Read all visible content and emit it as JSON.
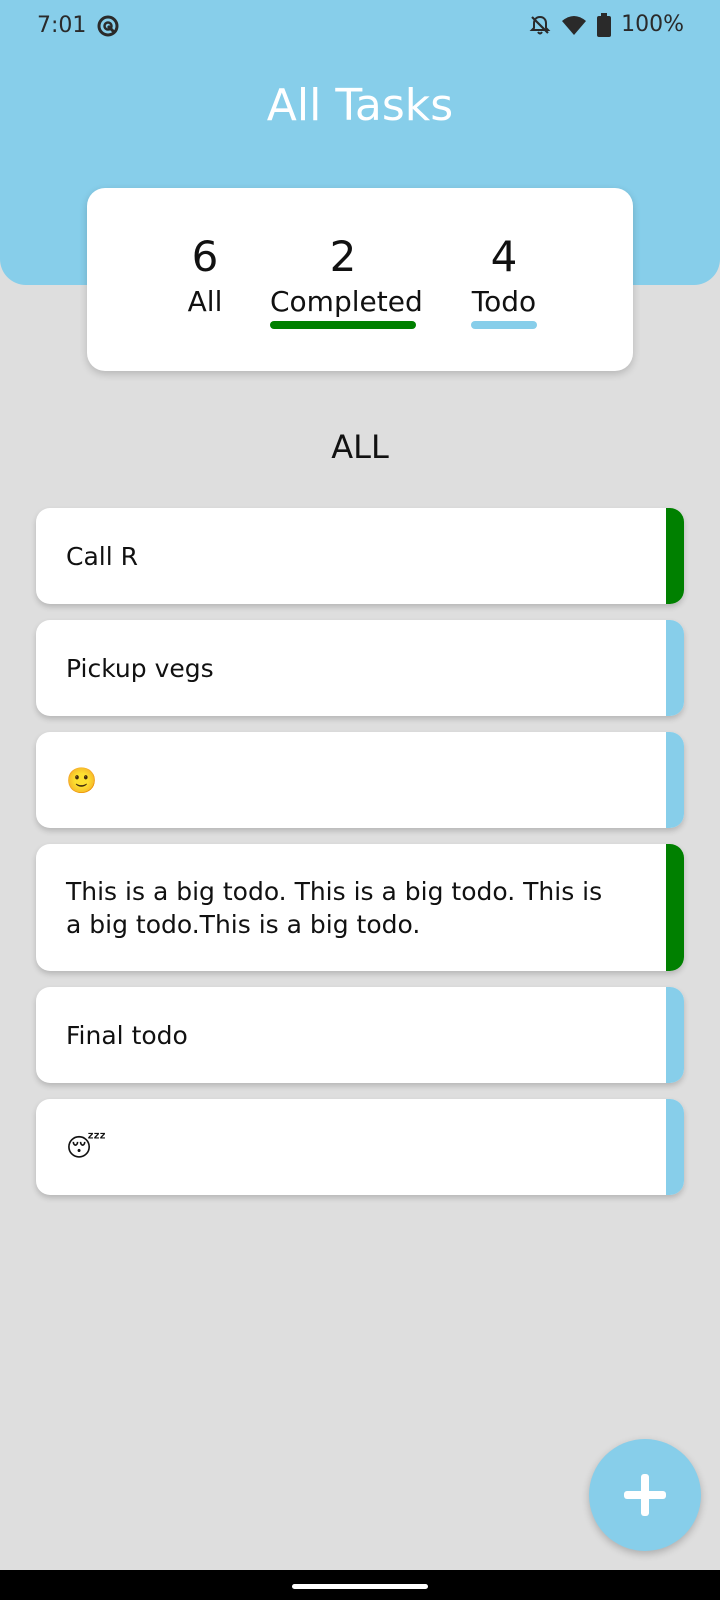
{
  "status_bar": {
    "time": "7:01",
    "battery": "100%",
    "icons": [
      "app-notification-icon",
      "mute-icon",
      "wifi-icon",
      "battery-icon"
    ]
  },
  "header": {
    "title": "All Tasks",
    "background_color": "#87ceea"
  },
  "summary": {
    "all": {
      "count": "6",
      "label": "All"
    },
    "completed": {
      "count": "2",
      "label": "Completed",
      "color": "#008000"
    },
    "todo": {
      "count": "4",
      "label": "Todo",
      "color": "#87ceea"
    }
  },
  "section_title": "ALL",
  "tasks": [
    {
      "text": "Call R",
      "status": "completed"
    },
    {
      "text": "Pickup vegs",
      "status": "todo"
    },
    {
      "text": "🙂",
      "status": "todo"
    },
    {
      "text": "This is a big todo. This is a big todo. This is a big todo.This is a big todo.",
      "status": "completed"
    },
    {
      "text": "Final todo",
      "status": "todo"
    },
    {
      "text": "😴",
      "status": "todo"
    }
  ],
  "colors": {
    "completed": "#008000",
    "todo": "#87ceea",
    "background": "#dedede"
  },
  "fab": {
    "icon": "plus-icon"
  }
}
